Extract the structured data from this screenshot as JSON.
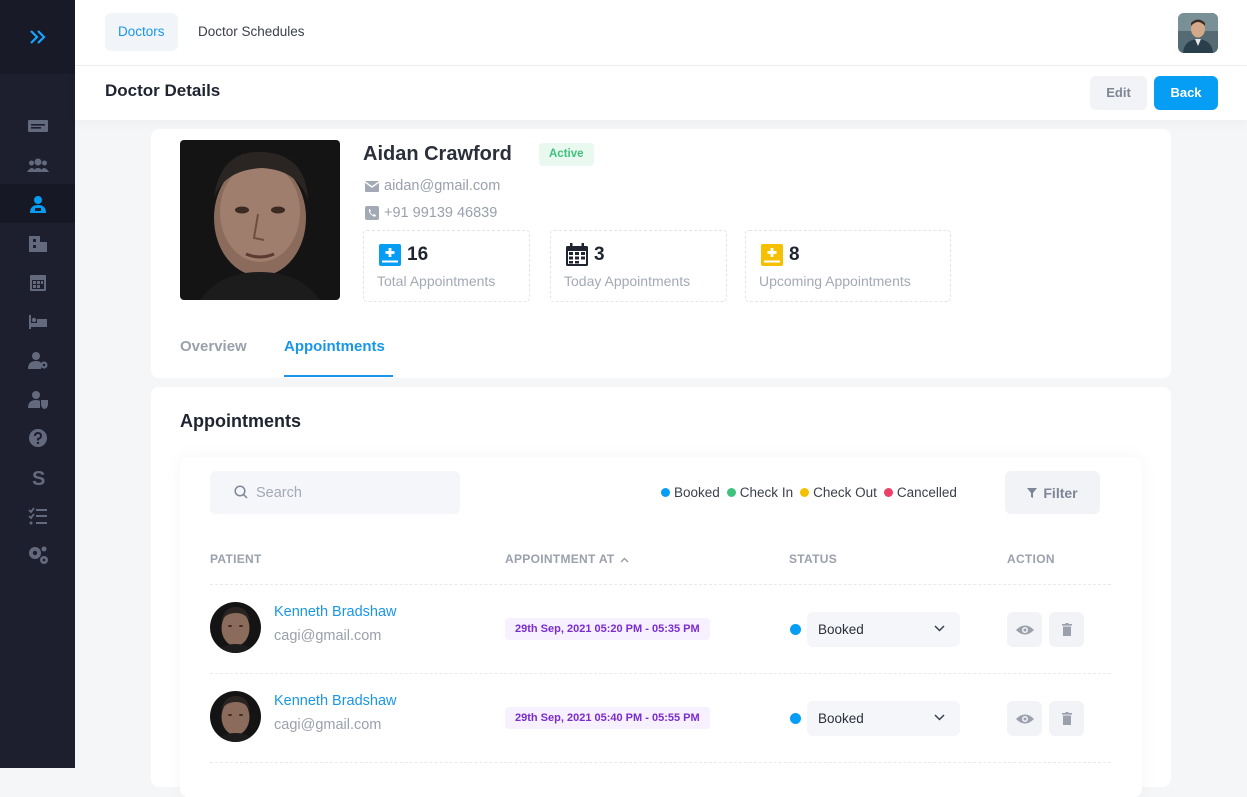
{
  "top_tabs": [
    {
      "label": "Doctors",
      "active": true
    },
    {
      "label": "Doctor Schedules",
      "active": false
    }
  ],
  "sidebar": {
    "items": [
      {
        "icon": "id-card-icon"
      },
      {
        "icon": "users-icon"
      },
      {
        "icon": "doctor-icon",
        "active": true
      },
      {
        "icon": "hospital-icon"
      },
      {
        "icon": "calendar-icon"
      },
      {
        "icon": "bed-icon"
      },
      {
        "icon": "user-cog-icon"
      },
      {
        "icon": "user-shield-icon"
      },
      {
        "icon": "help-icon"
      },
      {
        "icon": "s-logo-icon"
      },
      {
        "icon": "task-list-icon"
      },
      {
        "icon": "settings-icon"
      }
    ]
  },
  "header": {
    "title": "Doctor Details",
    "edit_label": "Edit",
    "back_label": "Back"
  },
  "profile": {
    "name": "Aidan Crawford",
    "status": "Active",
    "email": "aidan@gmail.com",
    "phone": "+91 99139 46839",
    "stats": [
      {
        "value": "16",
        "label": "Total Appointments",
        "color": "#069ef5"
      },
      {
        "value": "3",
        "label": "Today Appointments",
        "color": "#1f2430"
      },
      {
        "value": "8",
        "label": "Upcoming Appointments",
        "color": "#f5c000"
      }
    ],
    "tabs": [
      {
        "label": "Overview",
        "active": false
      },
      {
        "label": "Appointments",
        "active": true
      }
    ]
  },
  "appointments": {
    "title": "Appointments",
    "search_placeholder": "Search",
    "legend": [
      {
        "label": "Booked",
        "color": "#069ef5"
      },
      {
        "label": "Check In",
        "color": "#3fc27e"
      },
      {
        "label": "Check Out",
        "color": "#f5c000"
      },
      {
        "label": "Cancelled",
        "color": "#ee3f68"
      }
    ],
    "filter_label": "Filter",
    "columns": [
      "PATIENT",
      "APPOINTMENT AT",
      "STATUS",
      "ACTION"
    ],
    "rows": [
      {
        "patient_name": "Kenneth Bradshaw",
        "patient_email": "cagi@gmail.com",
        "time": "29th Sep, 2021 05:20 PM - 05:35 PM",
        "status": "Booked"
      },
      {
        "patient_name": "Kenneth Bradshaw",
        "patient_email": "cagi@gmail.com",
        "time": "29th Sep, 2021 05:40 PM - 05:55 PM",
        "status": "Booked"
      }
    ]
  }
}
